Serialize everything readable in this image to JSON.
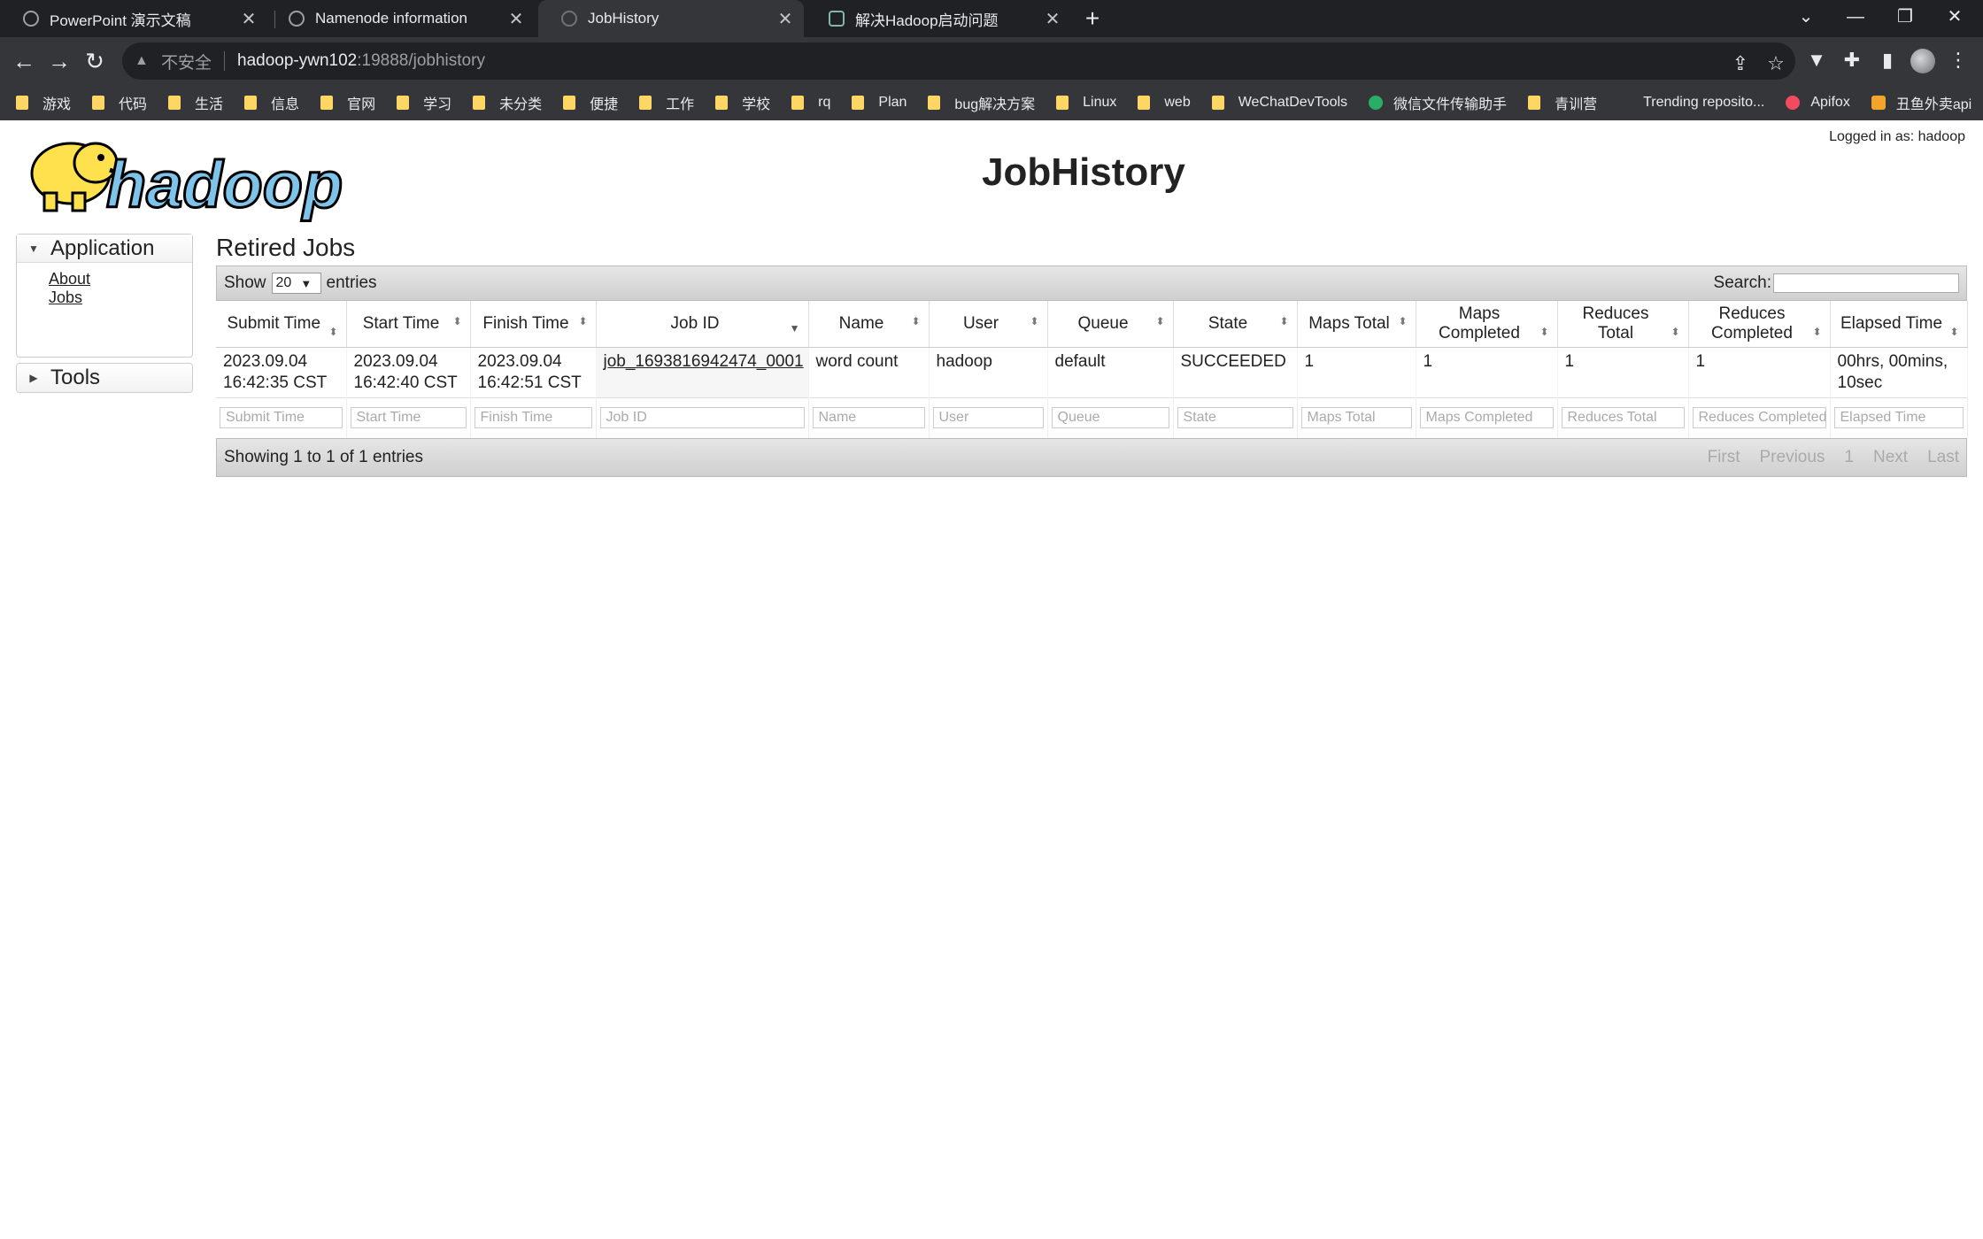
{
  "browser": {
    "tabs": [
      {
        "title": "PowerPoint 演示文稿"
      },
      {
        "title": "Namenode information"
      },
      {
        "title": "JobHistory"
      },
      {
        "title": "解决Hadoop启动问题"
      }
    ],
    "address": {
      "insecure_label": "不安全",
      "host": "hadoop-ywn102",
      "path": ":19888/jobhistory"
    },
    "bookmarks": [
      {
        "label": "游戏"
      },
      {
        "label": "代码"
      },
      {
        "label": "生活"
      },
      {
        "label": "信息"
      },
      {
        "label": "官网"
      },
      {
        "label": "学习"
      },
      {
        "label": "未分类"
      },
      {
        "label": "便捷"
      },
      {
        "label": "工作"
      },
      {
        "label": "学校"
      },
      {
        "label": "rq"
      },
      {
        "label": "Plan"
      },
      {
        "label": "bug解决方案"
      },
      {
        "label": "Linux"
      },
      {
        "label": "web"
      },
      {
        "label": "WeChatDevTools"
      },
      {
        "label": "微信文件传输助手"
      },
      {
        "label": "青训营"
      },
      {
        "label": "Trending reposito..."
      },
      {
        "label": "Apifox"
      },
      {
        "label": "丑鱼外卖api"
      }
    ]
  },
  "header": {
    "logo_text": "hadoop",
    "title": "JobHistory",
    "logged_in": "Logged in as: hadoop"
  },
  "nav": {
    "application": "Application",
    "about": "About",
    "jobs": "Jobs",
    "tools": "Tools"
  },
  "main": {
    "title": "Retired Jobs",
    "show_label": "Show",
    "page_length": "20",
    "entries_label": "entries",
    "search_label": "Search:",
    "columns": [
      "Submit Time",
      "Start Time",
      "Finish Time",
      "Job ID",
      "Name",
      "User",
      "Queue",
      "State",
      "Maps Total",
      "Maps Completed",
      "Reduces Total",
      "Reduces Completed",
      "Elapsed Time"
    ],
    "rows": [
      {
        "submit_time": "2023.09.04 16:42:35 CST",
        "start_time": "2023.09.04 16:42:40 CST",
        "finish_time": "2023.09.04 16:42:51 CST",
        "job_id": "job_1693816942474_0001",
        "name": "word count",
        "user": "hadoop",
        "queue": "default",
        "state": "SUCCEEDED",
        "maps_total": "1",
        "maps_completed": "1",
        "reduces_total": "1",
        "reduces_completed": "1",
        "elapsed_time": "00hrs, 00mins, 10sec"
      }
    ],
    "filters": [
      "Submit Time",
      "Start Time",
      "Finish Time",
      "Job ID",
      "Name",
      "User",
      "Queue",
      "State",
      "Maps Total",
      "Maps Completed",
      "Reduces Total",
      "Reduces Completed",
      "Elapsed Time"
    ],
    "info": "Showing 1 to 1 of 1 entries",
    "pager": {
      "first": "First",
      "previous": "Previous",
      "page": "1",
      "next": "Next",
      "last": "Last"
    }
  }
}
